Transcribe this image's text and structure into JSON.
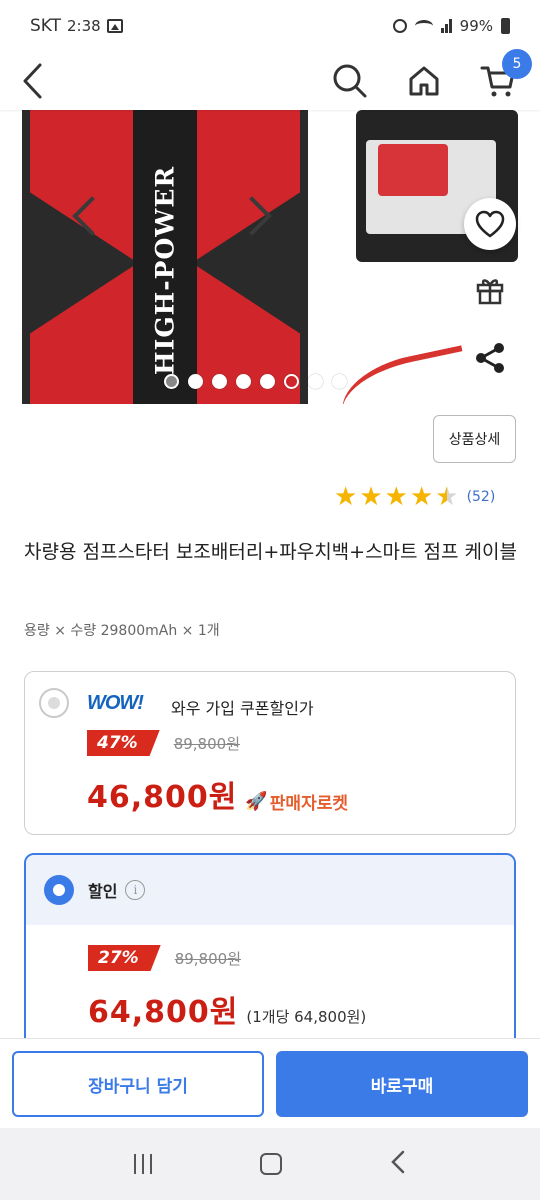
{
  "status_bar": {
    "carrier": "SKT",
    "time": "2:38",
    "battery": "99%"
  },
  "header": {
    "cart_count": "5"
  },
  "gallery": {
    "product_text": "HIGH-POWER",
    "dots_total": 8,
    "dots_active_index": 1
  },
  "detail_button": "상품상세",
  "rating": {
    "stars": 4.5,
    "review_count": "(52)"
  },
  "product": {
    "title": "차량용 점프스타터 보조배터리+파우치백+스마트 점프 케이블",
    "option": "용량 × 수량  29800mAh × 1개"
  },
  "wow_offer": {
    "logo": "WOW!",
    "label": "와우 가입 쿠폰할인가",
    "discount": "47%",
    "original_price": "89,800원",
    "price": "46,800원",
    "badge": "판매자로켓"
  },
  "sale_offer": {
    "label": "할인",
    "info_icon": "i",
    "discount": "27%",
    "original_price": "89,800원",
    "price": "64,800원",
    "unit_price": "(1개당 64,800원)"
  },
  "actions": {
    "add_to_cart": "장바구니 담기",
    "buy_now": "바로구매"
  },
  "colors": {
    "accent": "#3a7be8",
    "price_red": "#cc1f13",
    "star": "#f5b400"
  }
}
